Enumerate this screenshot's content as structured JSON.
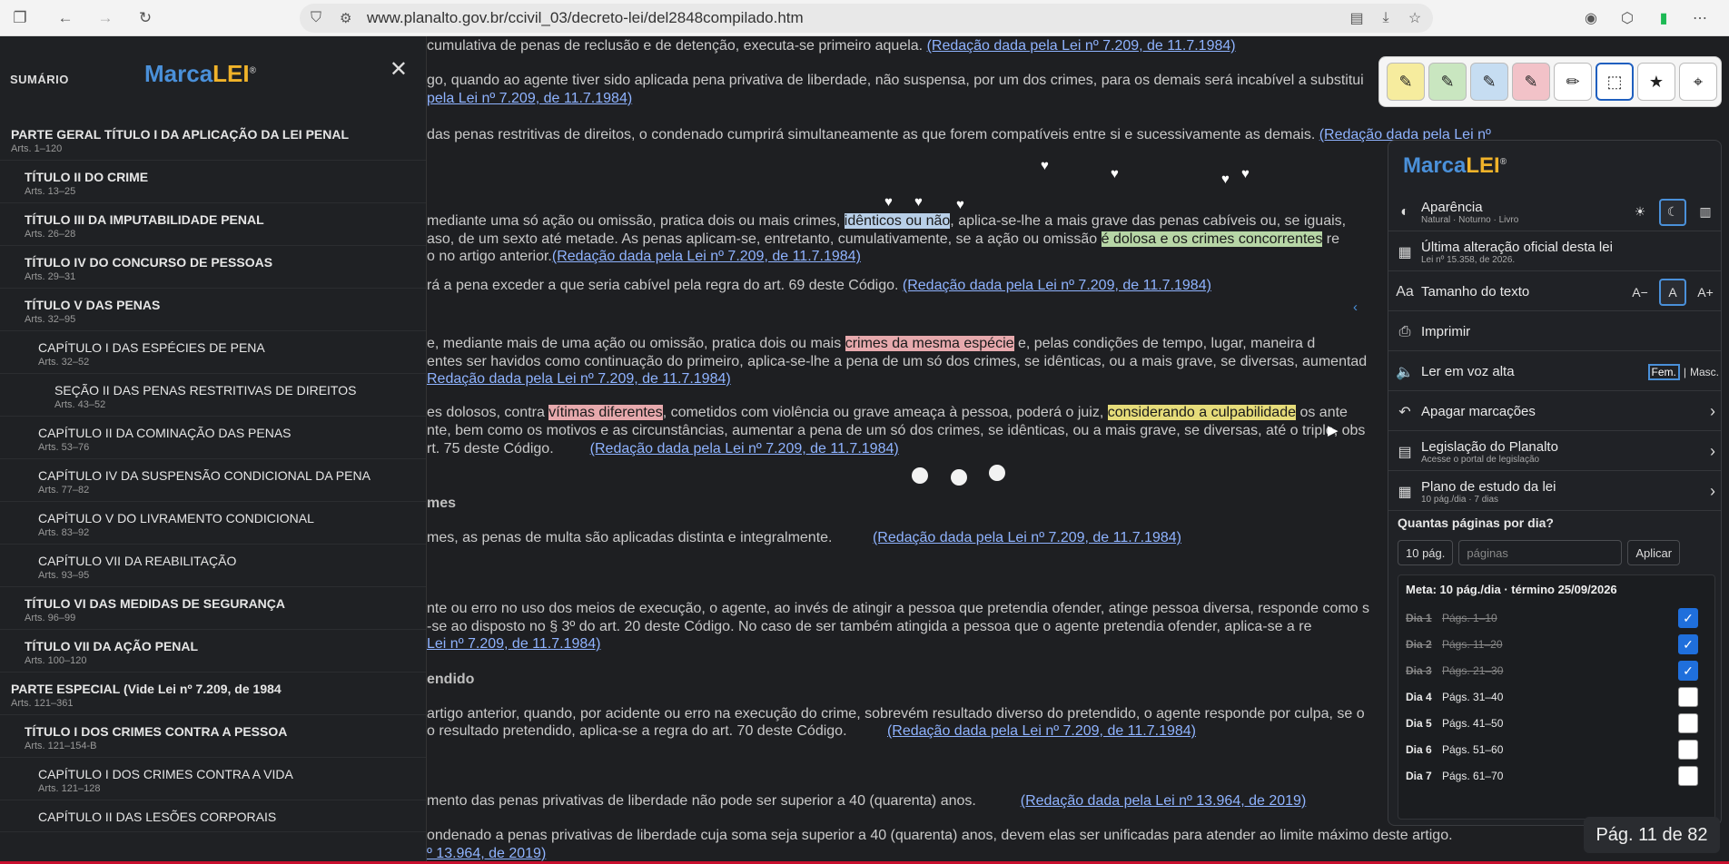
{
  "browser": {
    "url": "www.planalto.gov.br/ccivil_03/decreto-lei/del2848compilado.htm"
  },
  "brand": {
    "marca": "Marca",
    "lei": "LEI",
    "reg": "®"
  },
  "sidebar": {
    "label": "SUMÁRIO",
    "items": [
      {
        "title": "PARTE GERAL TÍTULO I DA APLICAÇÃO DA LEI PENAL",
        "sub": "Arts. 1–120",
        "level": 0
      },
      {
        "title": "TÍTULO II DO CRIME",
        "sub": "Arts. 13–25",
        "level": 1
      },
      {
        "title": "TÍTULO III DA IMPUTABILIDADE PENAL",
        "sub": "Arts. 26–28",
        "level": 1
      },
      {
        "title": "TÍTULO IV DO CONCURSO DE PESSOAS",
        "sub": "Arts. 29–31",
        "level": 1
      },
      {
        "title": "TÍTULO V DAS PENAS",
        "sub": "Arts. 32–95",
        "level": 1
      },
      {
        "title": "CAPÍTULO I DAS ESPÉCIES DE PENA",
        "sub": "Arts. 32–52",
        "level": 2
      },
      {
        "title": "SEÇÃO II DAS PENAS RESTRITIVAS DE DIREITOS",
        "sub": "Arts. 43–52",
        "level": 3
      },
      {
        "title": "CAPÍTULO II DA COMINAÇÃO DAS PENAS",
        "sub": "Arts. 53–76",
        "level": 2
      },
      {
        "title": "CAPÍTULO IV DA SUSPENSÃO CONDICIONAL DA PENA",
        "sub": "Arts. 77–82",
        "level": 2
      },
      {
        "title": "CAPÍTULO V DO LIVRAMENTO CONDICIONAL",
        "sub": "Arts. 83–92",
        "level": 2
      },
      {
        "title": "CAPÍTULO VII DA REABILITAÇÃO",
        "sub": "Arts. 93–95",
        "level": 2
      },
      {
        "title": "TÍTULO VI DAS MEDIDAS DE SEGURANÇA",
        "sub": "Arts. 96–99",
        "level": 1
      },
      {
        "title": "TÍTULO VII DA AÇÃO PENAL",
        "sub": "Arts. 100–120",
        "level": 1
      },
      {
        "title": "PARTE ESPECIAL (Vide Lei nº 7.209, de 1984",
        "sub": "Arts. 121–361",
        "level": 0
      },
      {
        "title": "TÍTULO I DOS CRIMES CONTRA A PESSOA",
        "sub": "Arts. 121–154-B",
        "level": 1
      },
      {
        "title": "CAPÍTULO I DOS CRIMES CONTRA A VIDA",
        "sub": "Arts. 121–128",
        "level": 2
      },
      {
        "title": "CAPÍTULO II DAS LESÕES CORPORAIS",
        "sub": "",
        "level": 2
      }
    ]
  },
  "doc": {
    "l1a": "cumulativa de penas de reclusão e de detenção, executa-se primeiro aquela. ",
    "l1link": "(Redação dada pela Lei nº 7.209, de 11.7.1984)",
    "l2a": "go, quando ao agente tiver sido aplicada pena privativa de liberdade, não suspensa, por um dos crimes, para os demais será incabível a substitui",
    "l3link": " pela Lei nº 7.209, de 11.7.1984)",
    "l4a": "das penas restritivas de direitos, o condenado cumprirá simultaneamente as que forem compatíveis entre si e sucessivamente as demais. ",
    "l4link": "(Redação dada pela Lei nº",
    "l5a": " mediante uma só ação ou omissão, pratica dois ou mais crimes, ",
    "l5hl": "idênticos ou não",
    "l5b": ", aplica-se-lhe a mais grave das penas cabíveis ou, se iguais,",
    "l6a": "aso, de um sexto até metade. As penas aplicam-se, entretanto, cumulativamente, se a ação ou omissão ",
    "l6hl": "é dolosa e os crimes concorrentes",
    "l6b": " re",
    "l7a": "o no artigo anterior.",
    "l7link": "(Redação dada pela Lei nº 7.209, de 11.7.1984)",
    "l8a": "rá a pena exceder a que seria cabível pela regra do art. 69 deste Código. ",
    "l8link": "(Redação dada pela Lei nº 7.209, de 11.7.1984)",
    "l9a": "e, mediante mais de uma ação ou omissão, pratica dois ou mais ",
    "l9hl": "crimes da mesma espécie",
    "l9b": " e, pelas condições de tempo, lugar, maneira d",
    "l10a": "entes ser havidos como continuação do primeiro, aplica-se-lhe a pena de um só dos crimes, se idênticas, ou a mais grave, se diversas, aumentad",
    "l11link": "Redação dada pela Lei nº 7.209, de 11.7.1984)",
    "l12a": "es dolosos, contra ",
    "l12hl1": "vítimas diferentes",
    "l12b": ", cometidos com violência ou grave ameaça à pessoa, poderá o juiz, ",
    "l12hl2": "considerando a culpabilidade",
    "l12c": " os ante",
    "l13a": "nte, bem como os motivos e as circunstâncias, aumentar a pena de um só dos crimes, se idênticas, ou a mais grave, se diversas, até o triplo, obs",
    "l14a": "rt. 75 deste Código.",
    "l14link": "(Redação dada pela Lei nº 7.209, de 11.7.1984)",
    "h1": "mes",
    "l15a": "mes, as penas de multa são aplicadas distinta e integralmente.",
    "l15link": "(Redação dada pela Lei nº 7.209, de 11.7.1984)",
    "l16a": "nte ou erro no uso dos meios de execução, o agente, ao invés de atingir a pessoa que pretendia ofender, atinge pessoa diversa, responde como s",
    "l17a": "-se ao disposto no § 3º do art. 20 deste Código. No caso de ser também atingida a pessoa que o agente pretendia ofender, aplica-se a re",
    "l18link": " Lei nº 7.209, de 11.7.1984)",
    "h2": "endido",
    "l19a": "artigo anterior, quando, por acidente ou erro na execução do crime, sobrevém resultado diverso do pretendido, o agente responde por culpa, se o",
    "l20a": "o resultado pretendido, aplica-se a regra do art. 70 deste Código.",
    "l20link": "(Redação dada pela Lei nº 7.209, de 11.7.1984)",
    "l21a": "mento das penas privativas de liberdade não pode ser superior a 40 (quarenta) anos.",
    "l21link": "(Redação dada pela Lei nº 13.964, de 2019)",
    "l22a": "ondenado a penas privativas de liberdade cuja soma seja superior a 40 (quarenta) anos, devem elas ser unificadas para atender ao limite máximo deste artigo.",
    "l23link": "º 13.964, de 2019)"
  },
  "toolbar": {
    "tools": [
      {
        "icon": "pen-yellow-icon",
        "color": "#f6ec9e"
      },
      {
        "icon": "pen-green-icon",
        "color": "#c9e6c0"
      },
      {
        "icon": "pen-blue-icon",
        "color": "#c6ddf2"
      },
      {
        "icon": "pen-red-icon",
        "color": "#f2c2c8"
      },
      {
        "icon": "pencil-icon",
        "color": "#ffffff"
      },
      {
        "icon": "eraser-icon",
        "color": "#ffffff"
      },
      {
        "icon": "star-icon",
        "color": "#ffffff"
      },
      {
        "icon": "crosshair-icon",
        "color": "#ffffff"
      }
    ]
  },
  "panel": {
    "appearance": {
      "label": "Aparência",
      "sub": "Natural · Noturno · Livro"
    },
    "last_change": {
      "label": "Última alteração oficial desta lei",
      "sub": "Lei nº 15.358, de 2026."
    },
    "text_size": {
      "label": "Tamanho do texto",
      "minus": "A−",
      "normal": "A",
      "plus": "A+"
    },
    "print": {
      "label": "Imprimir"
    },
    "read_aloud": {
      "label": "Ler em voz alta",
      "fem": "Fem.",
      "sep": "|",
      "masc": "Masc."
    },
    "clear": {
      "label": "Apagar marcações"
    },
    "planalto": {
      "label": "Legislação do Planalto",
      "sub": "Acesse o portal de legislação"
    },
    "study": {
      "label": "Plano de estudo da lei",
      "sub": "10 pág./dia · 7 dias"
    },
    "plan": {
      "question": "Quantas páginas por dia?",
      "value": "10 pág.",
      "placeholder": "páginas",
      "apply": "Aplicar",
      "meta": "Meta: 10 pág./dia · término 25/09/2026",
      "days": [
        {
          "label": "Dia 1",
          "pages": "Págs. 1–10",
          "done": true
        },
        {
          "label": "Dia 2",
          "pages": "Págs. 11–20",
          "done": true
        },
        {
          "label": "Dia 3",
          "pages": "Págs. 21–30",
          "done": true
        },
        {
          "label": "Dia 4",
          "pages": "Págs. 31–40",
          "done": false
        },
        {
          "label": "Dia 5",
          "pages": "Págs. 41–50",
          "done": false
        },
        {
          "label": "Dia 6",
          "pages": "Págs. 51–60",
          "done": false
        },
        {
          "label": "Dia 7",
          "pages": "Págs. 61–70",
          "done": false
        }
      ]
    }
  },
  "pager": "Pág. 11 de 82"
}
